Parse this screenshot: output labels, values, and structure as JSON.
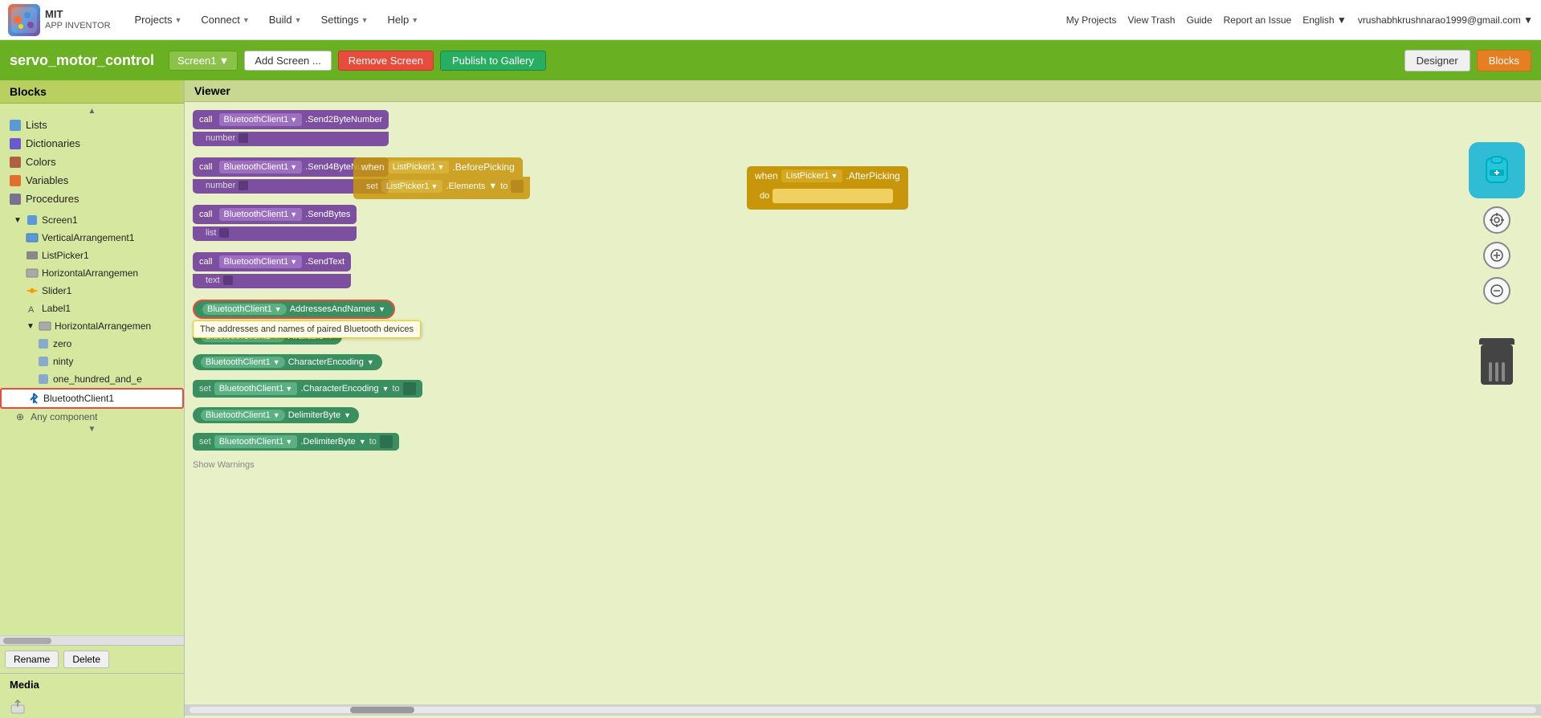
{
  "app": {
    "logo_text_line1": "MIT",
    "logo_text_line2": "APP INVENTOR"
  },
  "top_nav": {
    "items": [
      {
        "label": "Projects",
        "has_arrow": true
      },
      {
        "label": "Connect",
        "has_arrow": true
      },
      {
        "label": "Build",
        "has_arrow": true
      },
      {
        "label": "Settings",
        "has_arrow": true
      },
      {
        "label": "Help",
        "has_arrow": true
      }
    ],
    "right_items": [
      {
        "label": "My Projects"
      },
      {
        "label": "View Trash"
      },
      {
        "label": "Guide"
      },
      {
        "label": "Report an Issue"
      },
      {
        "label": "English",
        "has_arrow": true
      },
      {
        "label": "vrushabhkrushnarao1999@gmail.com",
        "has_arrow": true
      }
    ]
  },
  "project_bar": {
    "title": "servo_motor_control",
    "screen_name": "Screen1",
    "add_screen_label": "Add Screen ...",
    "remove_screen_label": "Remove Screen",
    "publish_label": "Publish to Gallery",
    "designer_label": "Designer",
    "blocks_label": "Blocks"
  },
  "sidebar": {
    "header": "Blocks",
    "categories": [
      {
        "label": "Lists",
        "color": "#5b9bd5"
      },
      {
        "label": "Dictionaries",
        "color": "#6a5acd"
      },
      {
        "label": "Colors",
        "color": "#b06040"
      },
      {
        "label": "Variables",
        "color": "#e07030"
      },
      {
        "label": "Procedures",
        "color": "#7a7090"
      }
    ],
    "tree": {
      "screen1": {
        "label": "Screen1",
        "expanded": true,
        "children": [
          {
            "label": "VerticalArrangement1",
            "icon": "arrangement"
          },
          {
            "label": "ListPicker1",
            "icon": "list"
          },
          {
            "label": "HorizontalArrangemen",
            "icon": "arrangement"
          },
          {
            "label": "Slider1",
            "icon": "slider"
          },
          {
            "label": "Label1",
            "icon": "label"
          },
          {
            "label": "HorizontalArrangemen",
            "icon": "arrangement",
            "expanded": true,
            "children": [
              {
                "label": "zero",
                "icon": "component"
              },
              {
                "label": "ninty",
                "icon": "component"
              },
              {
                "label": "one_hundred_and_e",
                "icon": "component"
              }
            ]
          },
          {
            "label": "BluetoothClient1",
            "icon": "bluetooth",
            "selected": true
          }
        ]
      }
    },
    "any_component": "Any component",
    "rename_label": "Rename",
    "delete_label": "Delete",
    "media_header": "Media"
  },
  "viewer": {
    "header": "Viewer",
    "blocks": [
      {
        "type": "call",
        "component": "BluetoothClient1",
        "method": ".Send2ByteNumber",
        "param": "number"
      },
      {
        "type": "call",
        "component": "BluetoothClient1",
        "method": ".Send4ByteNumber",
        "param": "number",
        "overlapping_event": {
          "component": "ListPicker1",
          "event": ".BeforePicking",
          "setter": {
            "component": "ListPicker1",
            "property": ".Elements",
            "to_connector": true
          }
        }
      },
      {
        "type": "call",
        "component": "BluetoothClient1",
        "method": ".SendBytes",
        "param": "list"
      },
      {
        "type": "call",
        "component": "BluetoothClient1",
        "method": ".SendText",
        "param": "text"
      },
      {
        "type": "getter",
        "component": "BluetoothClient1",
        "property": "AddressesAndNames",
        "selected": true,
        "tooltip": "The addresses and names of paired Bluetooth devices"
      },
      {
        "type": "getter",
        "component": "BluetoothClient1",
        "property": "Available"
      },
      {
        "type": "getter",
        "component": "BluetoothClient1",
        "property": "CharacterEncoding"
      },
      {
        "type": "set",
        "component": "BluetoothClient1",
        "property": "CharacterEncoding",
        "has_to": true
      },
      {
        "type": "getter",
        "component": "BluetoothClient1",
        "property": "DelimiterByte"
      },
      {
        "type": "set",
        "component": "BluetoothClient1",
        "property": "DelimiterByte",
        "has_to": true
      }
    ],
    "event_block": {
      "component": "ListPicker1",
      "event": ".AfterPicking",
      "do_slot": true
    },
    "show_warnings_label": "Show Warnings"
  },
  "controls": {
    "zoom_in": "+",
    "zoom_out": "−",
    "target": "⊙"
  }
}
